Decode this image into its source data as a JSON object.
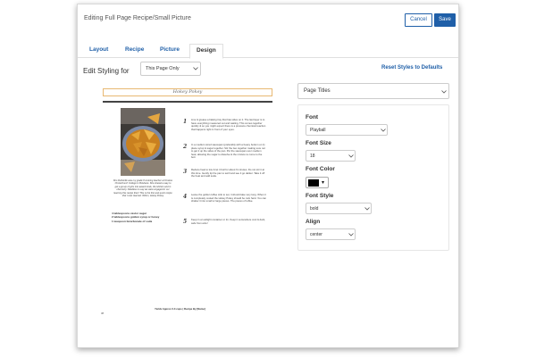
{
  "header": {
    "title": "Editing Full Page Recipe/Small Picture",
    "cancel_label": "Cancel",
    "save_label": "Save"
  },
  "tabs": [
    {
      "label": "Layout"
    },
    {
      "label": "Recipe"
    },
    {
      "label": "Picture"
    },
    {
      "label": "Design",
      "active": true
    }
  ],
  "styling": {
    "label": "Edit Styling for",
    "scope_value": "This Page Only",
    "reset_label": "Reset Styles to Defaults"
  },
  "panel": {
    "section_value": "Page Titles",
    "font_label": "Font",
    "font_value": "Playball",
    "font_size_label": "Font Size",
    "font_size_value": "18",
    "font_color_label": "Font Color",
    "font_color": "#000000",
    "font_style_label": "Font Style",
    "font_style_value": "bold",
    "align_label": "Align",
    "align_value": "center"
  },
  "preview": {
    "title": "Hokey Pokey",
    "description": "Mrs Rutherfie was my grade 8 cooking teacher at Onslow Christchurch College in Brisbane. She shared a way to get a group of girls into award kinds, the kitchen and in chemistry. Needless to say we were engaged in our learning this recipe then! This is the first and quick recipe that I ever learned. Wilton, Hokey Pokey",
    "ingredients": [
      "4 tablespoons castor sugar",
      "2 tablespoons golden syrup or honey",
      "1 teaspoon bicarbonate of soda"
    ],
    "steps": [
      {
        "num": "1",
        "text": "Line & grease a baking tray that has sides on it. The last layer is to have everything measured out and waiting. This comes together quickly & so you might expect there is a pressure chemical reaction that happens right in front of your eyes."
      },
      {
        "num": "2",
        "text": "In a medium sized saucepan (preferably with a heavy bottom on it) place syrup & sugar together. Stir the two together making sure not to get it up the sides of the pan. Put the saucepan over medium heat, allowing the sugar to dissolve & the mixture to come to the boil."
      },
      {
        "num": "3",
        "text": "Reduce heat to low & let it boil for about 6 minutes. Do not stir it at this time. Gently tip the pan to swirl and see it go darker. Take it off the heat and add soda."
      },
      {
        "num": "4",
        "text": "Leave the golden toffee sink to set, it should take very long. When it is completely cooled the Hokey Pokey should be rock hard. You can shatter it into small or large pieces. The pieces of toffee."
      },
      {
        "num": "5",
        "text": "Keep in an airtight container or tin. Keep it somewhere cool & dark, safe from ants!"
      }
    ],
    "footer": "Yields Approx 2-3 cups | Recipe By [Name]",
    "page_number": "38"
  }
}
